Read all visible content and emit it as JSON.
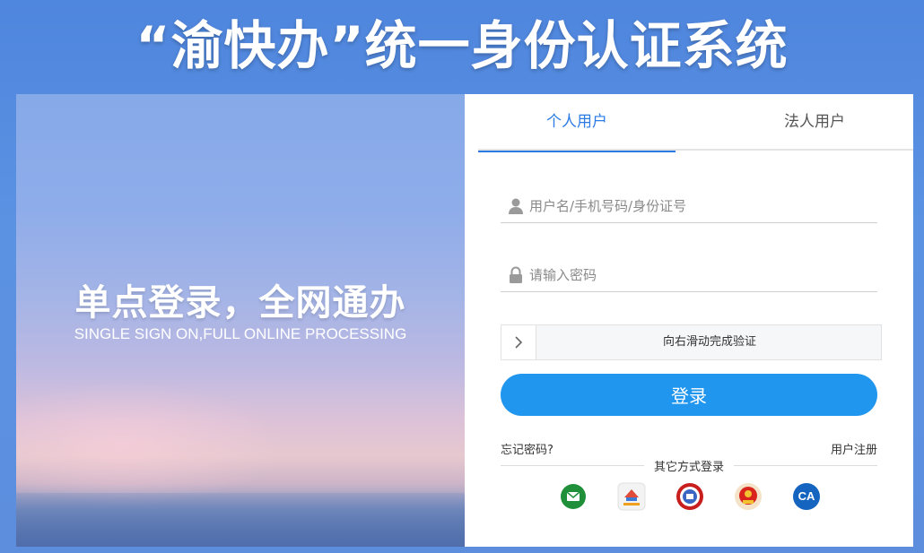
{
  "header": {
    "title": "“渝快办”统一身份认证系统"
  },
  "banner": {
    "slogan": "单点登录，全网通办",
    "slogan_en": "SINGLE SIGN ON,FULL ONLINE PROCESSING"
  },
  "login": {
    "tabs": [
      {
        "label": "个人用户",
        "active": true
      },
      {
        "label": "法人用户",
        "active": false
      }
    ],
    "username": {
      "value": "",
      "placeholder": "用户名/手机号码/身份证号",
      "icon": "user-icon"
    },
    "password": {
      "value": "",
      "placeholder": "请输入密码",
      "icon": "lock-icon"
    },
    "slider": {
      "text": "向右滑动完成验证",
      "icon": "chevron-right-icon"
    },
    "submit_label": "登录",
    "forgot_label": "忘记密码?",
    "register_label": "用户注册",
    "other_methods_label": "其它方式登录",
    "alt_methods": [
      {
        "icon": "wechat-icon",
        "color": "#1f8f3a"
      },
      {
        "icon": "gov-app-icon",
        "color": "#e04a3a"
      },
      {
        "icon": "seal-badge-icon",
        "color": "#c81e1e"
      },
      {
        "icon": "national-emblem-icon",
        "color": "#d4a017"
      },
      {
        "icon": "ca-icon",
        "color": "#1565c0",
        "text": "CA"
      }
    ]
  },
  "colors": {
    "accent": "#2c7be5",
    "button": "#2196ee"
  }
}
